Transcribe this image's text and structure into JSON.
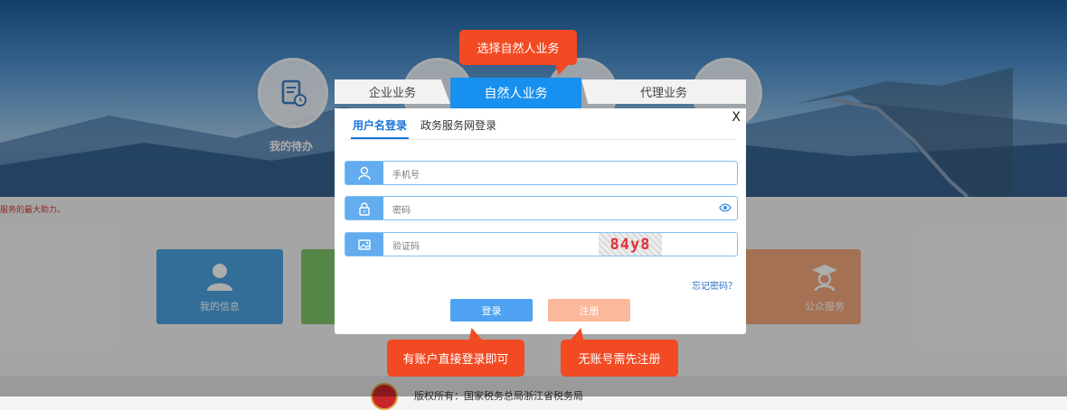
{
  "background": {
    "hero_items": [
      {
        "label": "我的待办",
        "icon": "document-clock-icon"
      }
    ],
    "notice_text": "服务的最大助力。",
    "cards": [
      {
        "label": "我的信息",
        "icon": "user-icon",
        "color": "#4aa3e0"
      },
      {
        "label": "",
        "icon": "",
        "color": "#7fc46a"
      },
      {
        "label": "公众服务",
        "icon": "graduate-icon",
        "color": "#f2a77c"
      }
    ],
    "footer_text": "版权所有：国家税务总局浙江省税务局"
  },
  "dialog": {
    "tabs": [
      {
        "label": "企业业务",
        "active": false
      },
      {
        "label": "自然人业务",
        "active": true
      },
      {
        "label": "代理业务",
        "active": false
      }
    ],
    "close_label": "X",
    "subtabs": [
      {
        "label": "用户名登录",
        "active": true
      },
      {
        "label": "政务服务网登录",
        "active": false
      }
    ],
    "fields": {
      "phone_placeholder": "手机号",
      "password_placeholder": "密码",
      "captcha_placeholder": "验证码",
      "captcha_text": "84y8"
    },
    "forgot_password": "忘记密码？",
    "login_button": "登录",
    "register_button": "注册"
  },
  "callouts": {
    "select_natural": "选择自然人业务",
    "login_hint": "有账户直接登录即可",
    "register_hint": "无账号需先注册"
  },
  "colors": {
    "accent": "#1890f0",
    "callout": "#f24a22",
    "login_button": "#4ea2f1",
    "register_button": "#fbb89a"
  }
}
